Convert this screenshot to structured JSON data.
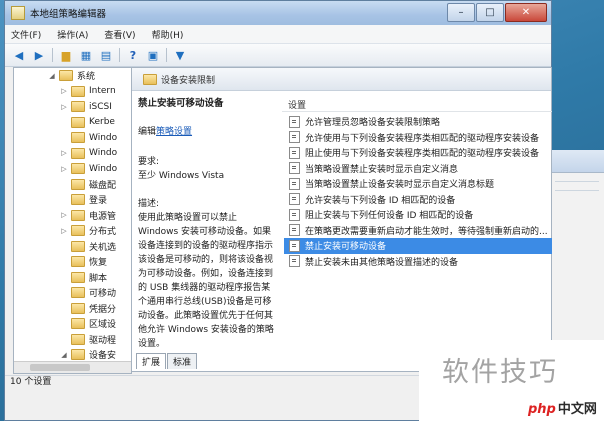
{
  "window": {
    "title": "本地组策略编辑器",
    "min": "–",
    "max": "□",
    "close": "✕"
  },
  "menu": [
    "文件(F)",
    "操作(A)",
    "查看(V)",
    "帮助(H)"
  ],
  "tree": [
    {
      "label": "系统",
      "expander": "◢",
      "indent": 0
    },
    {
      "label": "Intern",
      "expander": "▷",
      "indent": 1
    },
    {
      "label": "iSCSI",
      "expander": "▷",
      "indent": 1
    },
    {
      "label": "Kerbe",
      "expander": "",
      "indent": 1
    },
    {
      "label": "Windo",
      "expander": "",
      "indent": 1
    },
    {
      "label": "Windo",
      "expander": "▷",
      "indent": 1
    },
    {
      "label": "Windo",
      "expander": "▷",
      "indent": 1
    },
    {
      "label": "磁盘配",
      "expander": "",
      "indent": 1
    },
    {
      "label": "登录",
      "expander": "",
      "indent": 1
    },
    {
      "label": "电源管",
      "expander": "▷",
      "indent": 1
    },
    {
      "label": "分布式",
      "expander": "▷",
      "indent": 1
    },
    {
      "label": "关机选",
      "expander": "",
      "indent": 1
    },
    {
      "label": "恢复",
      "expander": "",
      "indent": 1
    },
    {
      "label": "脚本",
      "expander": "",
      "indent": 1
    },
    {
      "label": "可移动",
      "expander": "",
      "indent": 1
    },
    {
      "label": "凭据分",
      "expander": "",
      "indent": 1
    },
    {
      "label": "区域设",
      "expander": "",
      "indent": 1
    },
    {
      "label": "驱动程",
      "expander": "",
      "indent": 1
    },
    {
      "label": "设备安",
      "expander": "◢",
      "indent": 1
    },
    {
      "label": "",
      "expander": "",
      "indent": 2
    }
  ],
  "right_header": "设备安装限制",
  "description": {
    "title": "禁止安装可移动设备",
    "edit_prefix": "编辑",
    "edit_link": "策略设置",
    "req_label": "要求:",
    "req_value": "至少 Windows Vista",
    "desc_label": "描述:",
    "desc_text": "使用此策略设置可以禁止 Windows 安装可移动设备。如果设备连接到的设备的驱动程序指示该设备是可移动的，则将该设备视为可移动设备。例如，设备连接到的 USB 集线器的驱动程序报告某个通用串行总线(USB)设备是可移动设备。此策略设置优先于任何其他允许 Windows 安装设备的策略设置。"
  },
  "list_header": "设置",
  "policies": [
    "允许管理员忽略设备安装限制策略",
    "允许使用与下列设备安装程序类相匹配的驱动程序安装设备",
    "阻止使用与下列设备安装程序类相匹配的驱动程序安装设备",
    "当策略设置禁止安装时显示自定义消息",
    "当策略设置禁止设备安装时显示自定义消息标题",
    "允许安装与下列设备 ID 相匹配的设备",
    "阻止安装与下列任何设备 ID 相匹配的设备",
    "在策略更改需要重新启动才能生效时，等待强制重新启动的...",
    "禁止安装可移动设备",
    "禁止安装未由其他策略设置描述的设备"
  ],
  "selected_index": 8,
  "tabs": [
    "扩展",
    "标准"
  ],
  "status": "10 个设置",
  "watermark": {
    "text": "软件技巧",
    "php": "php",
    "site": "中文网"
  },
  "colors": {
    "selection": "#3c8be5",
    "link": "#1a5bb8"
  }
}
